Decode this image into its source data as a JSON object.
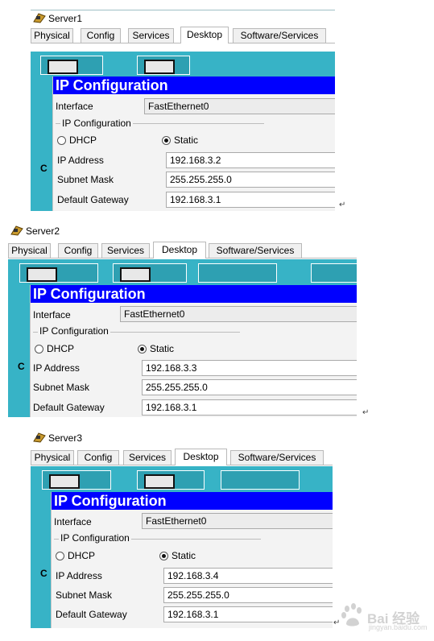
{
  "tabs": [
    "Physical",
    "Config",
    "Services",
    "Desktop",
    "Software/Services"
  ],
  "active_tab": "Desktop",
  "labels": {
    "heading": "IP Configuration",
    "interface": "Interface",
    "group": "IP Configuration",
    "dhcp": "DHCP",
    "static": "Static",
    "ip_address": "IP Address",
    "subnet_mask": "Subnet Mask",
    "default_gateway": "Default Gateway",
    "side_char": "C"
  },
  "servers": [
    {
      "name": "Server1",
      "interface": "FastEthernet0",
      "mode": "Static",
      "ip": "192.168.3.2",
      "mask": "255.255.255.0",
      "gateway": "192.168.3.1"
    },
    {
      "name": "Server2",
      "interface": "FastEthernet0",
      "mode": "Static",
      "ip": "192.168.3.3",
      "mask": "255.255.255.0",
      "gateway": "192.168.3.1"
    },
    {
      "name": "Server3",
      "interface": "FastEthernet0",
      "mode": "Static",
      "ip": "192.168.3.4",
      "mask": "255.255.255.0",
      "gateway": "192.168.3.1"
    }
  ],
  "return_mark": "↵",
  "watermark": {
    "text": "Bai 经验",
    "sub": "jingyan.baidu.com"
  },
  "colors": {
    "teal": "#37b3c6",
    "heading_bg": "#0000ff",
    "heading_fg": "#ffffff"
  }
}
